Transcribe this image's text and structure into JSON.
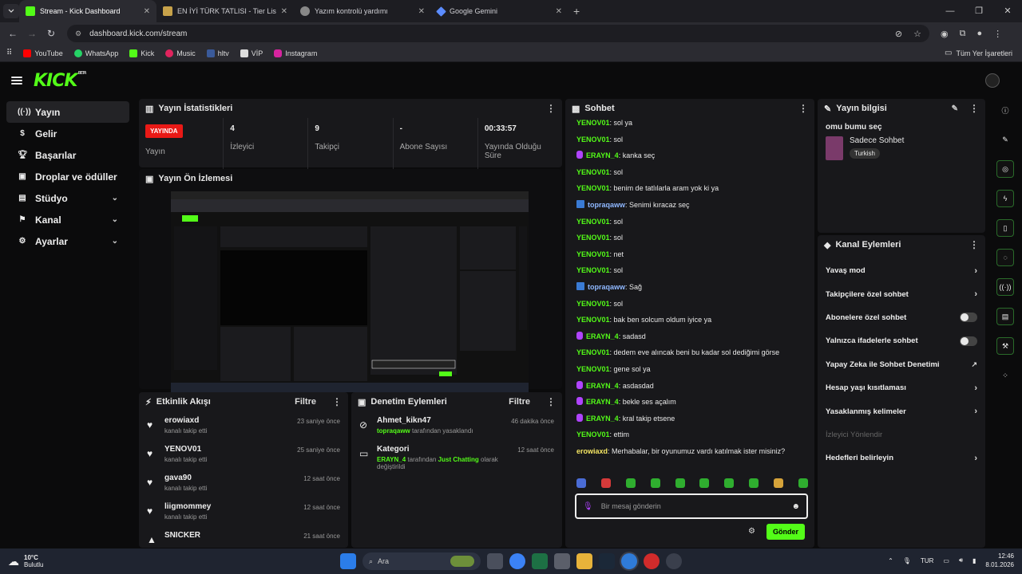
{
  "browser": {
    "tabs": [
      {
        "title": "Stream - Kick Dashboard",
        "active": true
      },
      {
        "title": "EN İYİ TÜRK TATLISI - Tier List,",
        "active": false
      },
      {
        "title": "Yazım kontrolü yardımı",
        "active": false
      },
      {
        "title": "Google Gemini",
        "active": false
      }
    ],
    "url": "dashboard.kick.com/stream",
    "bookmarks": [
      "YouTube",
      "WhatsApp",
      "Kick",
      "Music",
      "hltv",
      "VİP",
      "Instagram"
    ],
    "bookmarks_right": "Tüm Yer İşaretleri"
  },
  "app": {
    "logo": "KICK",
    "beta": "BETA",
    "accent": "#53fc18"
  },
  "sidebar": {
    "items": [
      {
        "label": "Yayın",
        "icon": "live-icon",
        "active": true,
        "chevron": false
      },
      {
        "label": "Gelir",
        "icon": "dollar-icon",
        "active": false,
        "chevron": false
      },
      {
        "label": "Başarılar",
        "icon": "trophy-icon",
        "active": false,
        "chevron": false
      },
      {
        "label": "Droplar ve ödüller",
        "icon": "gift-icon",
        "active": false,
        "chevron": false
      },
      {
        "label": "Stüdyo",
        "icon": "studio-icon",
        "active": false,
        "chevron": true
      },
      {
        "label": "Kanal",
        "icon": "channel-icon",
        "active": false,
        "chevron": true
      },
      {
        "label": "Ayarlar",
        "icon": "gear-icon",
        "active": false,
        "chevron": true
      }
    ]
  },
  "stats": {
    "title": "Yayın İstatistikleri",
    "live_badge": "YAYINDA",
    "live_label": "Yayın",
    "items": [
      {
        "value": "4",
        "label": "İzleyici"
      },
      {
        "value": "9",
        "label": "Takipçi"
      },
      {
        "value": "-",
        "label": "Abone Sayısı"
      },
      {
        "value": "00:33:57",
        "label": "Yayında Olduğu Süre"
      }
    ]
  },
  "preview": {
    "title": "Yayın Ön İzlemesi"
  },
  "activity": {
    "title": "Etkinlik Akışı",
    "filter": "Filtre",
    "items": [
      {
        "name": "erowiaxd",
        "sub": "kanalı takip etti",
        "time": "23 saniye önce"
      },
      {
        "name": "YENOV01",
        "sub": "kanalı takip etti",
        "time": "25 saniye önce"
      },
      {
        "name": "gava90",
        "sub": "kanalı takip etti",
        "time": "12 saat önce"
      },
      {
        "name": "liigmommey",
        "sub": "kanalı takip etti",
        "time": "12 saat önce"
      },
      {
        "name": "SNICKER",
        "sub": "",
        "time": "21 saat önce"
      }
    ]
  },
  "moderation": {
    "title": "Denetim Eylemleri",
    "filter": "Filtre",
    "items": [
      {
        "name": "Ahmet_kikn47",
        "actor": "topraqaww",
        "rest": "tarafından yasaklandı",
        "mid": "",
        "tail": "",
        "time": "46 dakika önce"
      },
      {
        "name": "Kategori",
        "actor": "ERAYN_4",
        "rest": "tarafından",
        "mid": "Just Chatting",
        "tail": "olarak değiştirildi",
        "time": "12 saat önce"
      }
    ]
  },
  "chat": {
    "title": "Sohbet",
    "messages": [
      {
        "user": "YENOV01",
        "text": "sol ya",
        "color": "#53fc18",
        "badge": ""
      },
      {
        "user": "YENOV01",
        "text": "sol",
        "color": "#53fc18",
        "badge": ""
      },
      {
        "user": "ERAYN_4",
        "text": "kanka seç",
        "color": "#53fc18",
        "badge": "mic"
      },
      {
        "user": "YENOV01",
        "text": "sol",
        "color": "#53fc18",
        "badge": ""
      },
      {
        "user": "YENOV01",
        "text": "benim de tatlılarla aram yok ki ya",
        "color": "#53fc18",
        "badge": ""
      },
      {
        "user": "topraqaww",
        "text": "Senimi kıracaz seç",
        "color": "#8fb8ff",
        "badge": "mod"
      },
      {
        "user": "YENOV01",
        "text": "sol",
        "color": "#53fc18",
        "badge": ""
      },
      {
        "user": "YENOV01",
        "text": "sol",
        "color": "#53fc18",
        "badge": ""
      },
      {
        "user": "YENOV01",
        "text": "net",
        "color": "#53fc18",
        "badge": ""
      },
      {
        "user": "YENOV01",
        "text": "sol",
        "color": "#53fc18",
        "badge": ""
      },
      {
        "user": "topraqaww",
        "text": "Sağ",
        "color": "#8fb8ff",
        "badge": "mod"
      },
      {
        "user": "YENOV01",
        "text": "sol",
        "color": "#53fc18",
        "badge": ""
      },
      {
        "user": "YENOV01",
        "text": "bak ben solcum oldum iyice ya",
        "color": "#53fc18",
        "badge": ""
      },
      {
        "user": "ERAYN_4",
        "text": "sadasd",
        "color": "#53fc18",
        "badge": "mic"
      },
      {
        "user": "YENOV01",
        "text": "dedem eve alıncak beni bu kadar sol dediğimi görse",
        "color": "#53fc18",
        "badge": ""
      },
      {
        "user": "YENOV01",
        "text": "gene sol ya",
        "color": "#53fc18",
        "badge": ""
      },
      {
        "user": "ERAYN_4",
        "text": "asdasdad",
        "color": "#53fc18",
        "badge": "mic"
      },
      {
        "user": "ERAYN_4",
        "text": "bekle ses açalım",
        "color": "#53fc18",
        "badge": "mic"
      },
      {
        "user": "ERAYN_4",
        "text": "kral takip etsene",
        "color": "#53fc18",
        "badge": "mic"
      },
      {
        "user": "YENOV01",
        "text": "ettim",
        "color": "#53fc18",
        "badge": ""
      },
      {
        "user": "erowiaxd",
        "text": "Merhabalar, bir oyunumuz vardı katılmak ister misiniz?",
        "color": "#f5e663",
        "badge": ""
      }
    ],
    "input_placeholder": "Bir mesaj gönderin",
    "send_label": "Gönder"
  },
  "stream_info": {
    "title": "Yayın bilgisi",
    "stream_title": "omu bumu seç",
    "category": "Sadece Sohbet",
    "language": "Turkish"
  },
  "channel_actions": {
    "title": "Kanal Eylemleri",
    "items": [
      {
        "label": "Yavaş mod",
        "control": "chevron"
      },
      {
        "label": "Takipçilere özel sohbet",
        "control": "chevron"
      },
      {
        "label": "Abonelere özel sohbet",
        "control": "toggle"
      },
      {
        "label": "Yalnızca ifadelerle sohbet",
        "control": "toggle"
      },
      {
        "label": "Yapay Zeka ile Sohbet Denetimi",
        "control": "external"
      },
      {
        "label": "Hesap yaşı kısıtlaması",
        "control": "chevron"
      },
      {
        "label": "Yasaklanmış kelimeler",
        "control": "chevron"
      },
      {
        "label": "İzleyici Yönlendir",
        "control": "disabled"
      },
      {
        "label": "Hedefleri belirleyin",
        "control": "chevron"
      }
    ]
  },
  "taskbar": {
    "temp": "10°C",
    "weather": "Bulutlu",
    "search": "Ara",
    "lang": "TUR",
    "time": "12:46",
    "date": "8.01.2026"
  }
}
